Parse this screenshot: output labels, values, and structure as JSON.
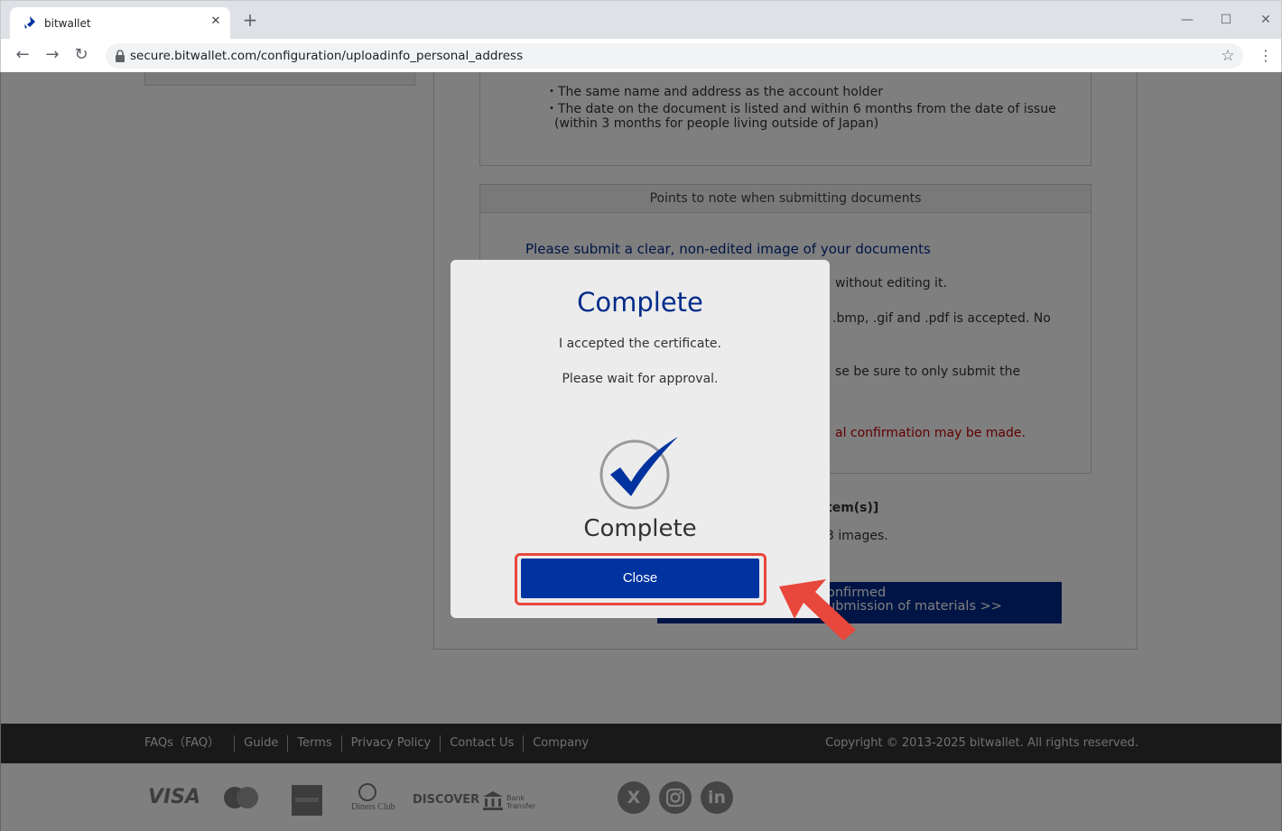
{
  "browser": {
    "tab_title": "bitwallet",
    "tab_close": "✕",
    "new_tab": "+",
    "url": "secure.bitwallet.com/configuration/uploadinfo_personal_address",
    "window_controls": {
      "minimize": "—",
      "maximize": "☐",
      "close": "✕"
    },
    "nav": {
      "back": "←",
      "forward": "→",
      "reload": "↻"
    },
    "star": "☆",
    "menu": "⋮"
  },
  "requirements": {
    "bullets": [
      "・The same name and address as the account holder",
      "・The date on the document is listed and within 6 months from the date of issue",
      "(within 3 months for people living outside of Japan)"
    ]
  },
  "notes": {
    "header": "Points to note when submitting documents",
    "lead": "Please submit a clear, non-edited image of your documents",
    "line1": "without editing it.",
    "line2": ".bmp, .gif and .pdf is accepted. No",
    "line3": "se be sure to only submit the",
    "red_line": "al confirmation may be made."
  },
  "upload": {
    "items_label": "tem(s)]",
    "images_label": "3 images.",
    "confirm_line1": "onfirmed",
    "confirm_line2": "ubmission of materials >>"
  },
  "footer": {
    "links": [
      "FAQs（FAQ）",
      "Guide",
      "Terms",
      "Privacy Policy",
      "Contact Us",
      "Company"
    ],
    "copyright": "Copyright © 2013-2025 bitwallet. All rights reserved.",
    "payments": {
      "visa": "VISA",
      "discover": "DISCOVER",
      "diners": "Diners Club",
      "bank": "Bank Transfer"
    },
    "social": {
      "x": "X",
      "linkedin": "in"
    }
  },
  "modal": {
    "title": "Complete",
    "message1": "I accepted the certificate.",
    "message2": "Please wait for approval.",
    "status": "Complete",
    "close_label": "Close"
  },
  "colors": {
    "brand_blue": "#0033a0",
    "highlight_red": "#e8473b"
  }
}
